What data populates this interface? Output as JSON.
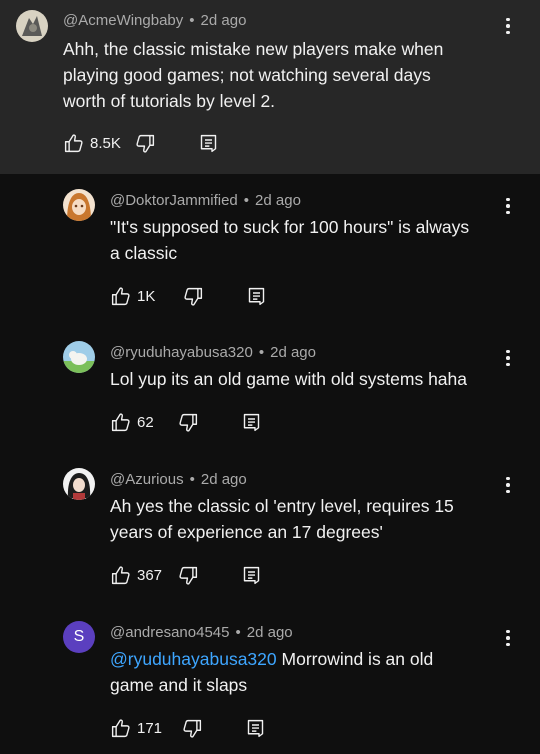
{
  "comments": [
    {
      "handle": "@AcmeWingbaby",
      "time": "2d ago",
      "lines": [
        "Ahh, the classic mistake new players make when",
        "playing good games; not watching several days",
        "worth of tutorials by level 2."
      ],
      "likes": "8.5K"
    },
    {
      "handle": "@DoktorJammified",
      "time": "2d ago",
      "lines": [
        "\"It's supposed to suck for 100 hours\" is always",
        "a classic"
      ],
      "likes": "1K"
    },
    {
      "handle": "@ryuduhayabusa320",
      "time": "2d ago",
      "lines": [
        "Lol yup its an old game with old systems haha"
      ],
      "likes": "62"
    },
    {
      "handle": "@Azurious",
      "time": "2d ago",
      "lines": [
        "Ah yes the classic ol 'entry level, requires 15",
        "years of experience an 17 degrees'"
      ],
      "likes": "367"
    },
    {
      "handle": "@andresano4545",
      "time": "2d ago",
      "avatar_letter": "S",
      "mention": "@ryuduhayabusa320",
      "line1_rest": " Morrowind is an old",
      "line2": "game and it slaps",
      "likes": "171"
    }
  ],
  "icons": {
    "like": "thumbs-up-icon",
    "dislike": "thumbs-down-icon",
    "reply": "reply-icon",
    "more": "kebab-menu-icon"
  },
  "colors": {
    "mention": "#3ea6ff",
    "avatar_s": "#5b3fbf",
    "top_bg": "#272727",
    "bg": "#0f0f0f"
  }
}
